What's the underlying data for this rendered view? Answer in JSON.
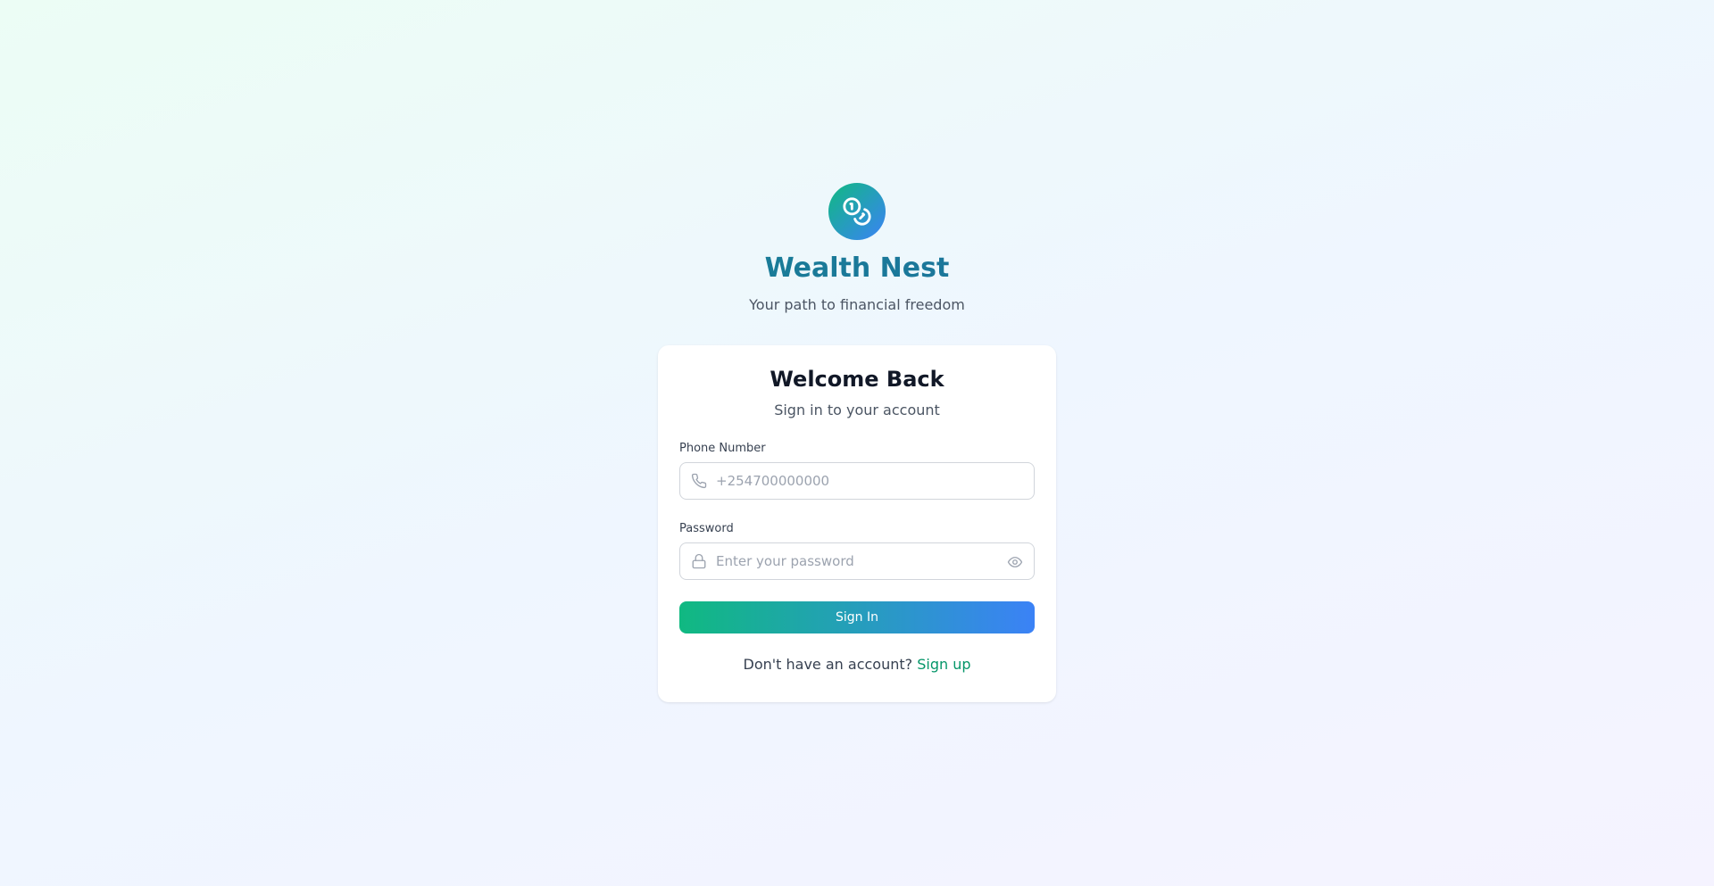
{
  "brand": {
    "logo_icon": "coins-icon",
    "title": "Wealth Nest",
    "tagline": "Your path to financial freedom"
  },
  "login": {
    "title": "Welcome Back",
    "subtitle": "Sign in to your account",
    "phone": {
      "label": "Phone Number",
      "placeholder": "+254700000000",
      "value": "",
      "icon": "phone-icon"
    },
    "password": {
      "label": "Password",
      "placeholder": "Enter your password",
      "value": "",
      "icon": "lock-icon",
      "toggle_icon": "eye-icon"
    },
    "submit_label": "Sign In",
    "signup_prompt": "Don't have an account?",
    "signup_link": "Sign up"
  },
  "colors": {
    "gradient_start": "#10b981",
    "gradient_end": "#3b82f6",
    "link": "#059669",
    "heading": "#111827",
    "muted_text": "#4b5563"
  }
}
